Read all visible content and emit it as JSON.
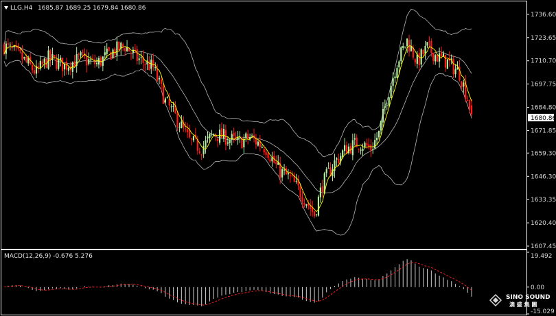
{
  "header": {
    "symbol_label": "LLG,H4",
    "ohlc_label": "1685.87 1689.25 1679.84 1680.86"
  },
  "macd_panel": {
    "label": "MACD(12,26,9) -0.676 5.276",
    "ticks": [
      "19.492",
      "0.00",
      "-15.029"
    ]
  },
  "logo": {
    "line1": "SINO SOUND",
    "line2": "澳 盛 集 團"
  },
  "colors": {
    "up": "#00cc00",
    "down": "#ff0000",
    "bull_candle": "#b4f0a0",
    "bear_candle": "#ff1a1a",
    "ma": "#ffff00",
    "bands": "#b8b8b8",
    "signal": "#ff2020",
    "histogram": "#d0d0d0",
    "background": "#000000"
  },
  "chart_data": [
    {
      "type": "candlestick",
      "title": "LLG,H4",
      "last_price_label": "1680.86",
      "ylim": [
        1607.45,
        1740
      ],
      "y_ticks": [
        1736.6,
        1723.65,
        1710.7,
        1697.75,
        1684.8,
        1671.85,
        1659.3,
        1646.3,
        1633.35,
        1620.4,
        1607.45
      ],
      "y_tick_labels": [
        "1736.60",
        "1723.65",
        "1710.70",
        "1697.75",
        "1684.80",
        "1671.85",
        "1659.30",
        "1646.30",
        "1633.35",
        "1620.40",
        "1607.45"
      ],
      "last_candle": {
        "open": 1685.87,
        "high": 1689.25,
        "low": 1679.84,
        "close": 1680.86
      },
      "path_points": [
        [
          0,
          1719
        ],
        [
          8,
          1713
        ],
        [
          16,
          1704
        ],
        [
          22,
          1712
        ],
        [
          30,
          1708
        ],
        [
          38,
          1712
        ],
        [
          46,
          1709
        ],
        [
          54,
          1716
        ],
        [
          60,
          1719
        ],
        [
          66,
          1712
        ],
        [
          74,
          1707
        ],
        [
          80,
          1688
        ],
        [
          86,
          1678
        ],
        [
          92,
          1666
        ],
        [
          98,
          1662
        ],
        [
          104,
          1670
        ],
        [
          110,
          1668
        ],
        [
          116,
          1665
        ],
        [
          122,
          1668
        ],
        [
          130,
          1662
        ],
        [
          136,
          1650
        ],
        [
          142,
          1645
        ],
        [
          148,
          1636
        ],
        [
          154,
          1625
        ],
        [
          158,
          1642
        ],
        [
          164,
          1654
        ],
        [
          170,
          1662
        ],
        [
          176,
          1665
        ],
        [
          182,
          1662
        ],
        [
          186,
          1670
        ],
        [
          190,
          1690
        ],
        [
          195,
          1710
        ],
        [
          200,
          1722
        ],
        [
          205,
          1710
        ],
        [
          210,
          1718
        ],
        [
          215,
          1713
        ],
        [
          220,
          1710
        ],
        [
          226,
          1704
        ],
        [
          230,
          1690
        ],
        [
          232,
          1681
        ]
      ],
      "n_bars": 233,
      "overlays": [
        "bollinger-bands",
        "moving-average"
      ],
      "grid": false
    },
    {
      "type": "macd",
      "title": "MACD(12,26,9) -0.676 5.276",
      "params": [
        12,
        26,
        9
      ],
      "main": -0.676,
      "signal": 5.276,
      "ylim": [
        -15.029,
        19.492
      ],
      "y_ticks": [
        19.492,
        0.0,
        -15.029
      ]
    }
  ]
}
